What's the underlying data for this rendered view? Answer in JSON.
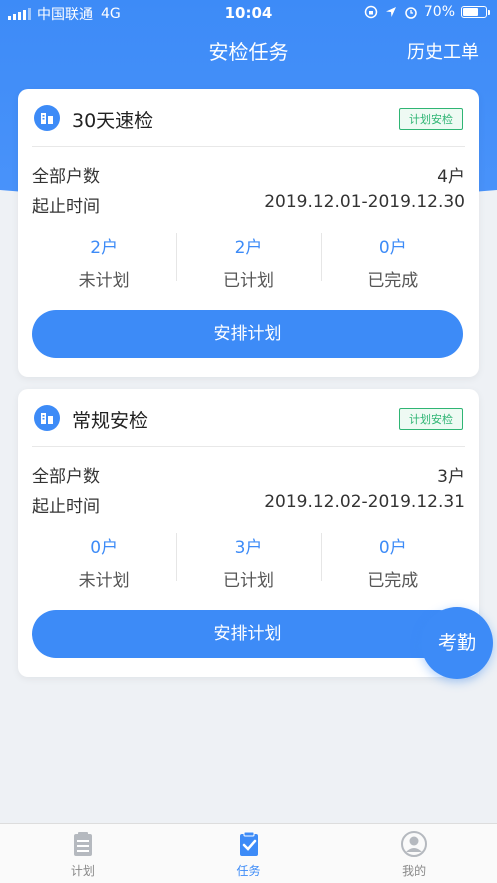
{
  "status_bar": {
    "carrier": "中国联通",
    "network": "4G",
    "time": "10:04",
    "battery": "70%",
    "battery_level": 0.7
  },
  "nav": {
    "title": "安检任务",
    "right_action": "历史工单"
  },
  "tasks": [
    {
      "title": "30天速检",
      "tag": "计划安检",
      "total_label": "全部户数",
      "total_value": "4户",
      "period_label": "起止时间",
      "period_value": "2019.12.01-2019.12.30",
      "stats": [
        {
          "num": "2户",
          "label": "未计划"
        },
        {
          "num": "2户",
          "label": "已计划"
        },
        {
          "num": "0户",
          "label": "已完成"
        }
      ],
      "button": "安排计划"
    },
    {
      "title": "常规安检",
      "tag": "计划安检",
      "total_label": "全部户数",
      "total_value": "3户",
      "period_label": "起止时间",
      "period_value": "2019.12.02-2019.12.31",
      "stats": [
        {
          "num": "0户",
          "label": "未计划"
        },
        {
          "num": "3户",
          "label": "已计划"
        },
        {
          "num": "0户",
          "label": "已完成"
        }
      ],
      "button": "安排计划"
    }
  ],
  "float_button": "考勤",
  "tabbar": [
    {
      "label": "计划",
      "icon": "clipboard-list-icon"
    },
    {
      "label": "任务",
      "icon": "clipboard-check-icon"
    },
    {
      "label": "我的",
      "icon": "user-icon"
    }
  ],
  "colors": {
    "primary": "#3d8bf7",
    "tag_green": "#2fb574",
    "background": "#eef1f5"
  }
}
